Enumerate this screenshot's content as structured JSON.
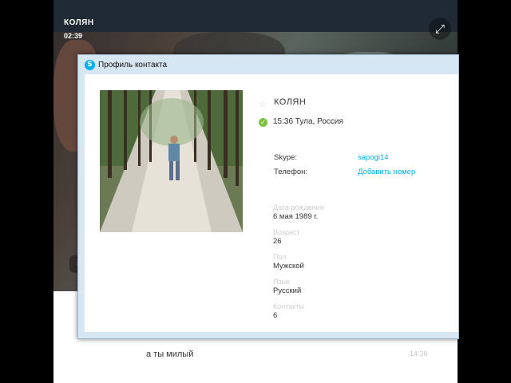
{
  "call": {
    "contact_name": "КОЛЯН",
    "duration": "02:39",
    "expand_icon": "expand-icon"
  },
  "chat": {
    "message": "а ты милый",
    "message_time": "14:36"
  },
  "dialog": {
    "title": "Профиль контакта",
    "contact_name": "КОЛЯН",
    "location": "15:36 Тула, Россия",
    "skype_label": "Skype:",
    "skype_value": "sapogi14",
    "phone_label": "Телефон:",
    "phone_action": "Добавить номер",
    "fields": [
      {
        "caption": "Дата рождения",
        "value": "6 мая 1989 г."
      },
      {
        "caption": "Возраст",
        "value": "26"
      },
      {
        "caption": "Пол",
        "value": "Мужской"
      },
      {
        "caption": "Язык",
        "value": "Русский"
      },
      {
        "caption": "Контакты",
        "value": "6"
      }
    ]
  },
  "colors": {
    "accent": "#00aff0",
    "online": "#7cc242",
    "dialog_frame": "#d7e6f3"
  }
}
